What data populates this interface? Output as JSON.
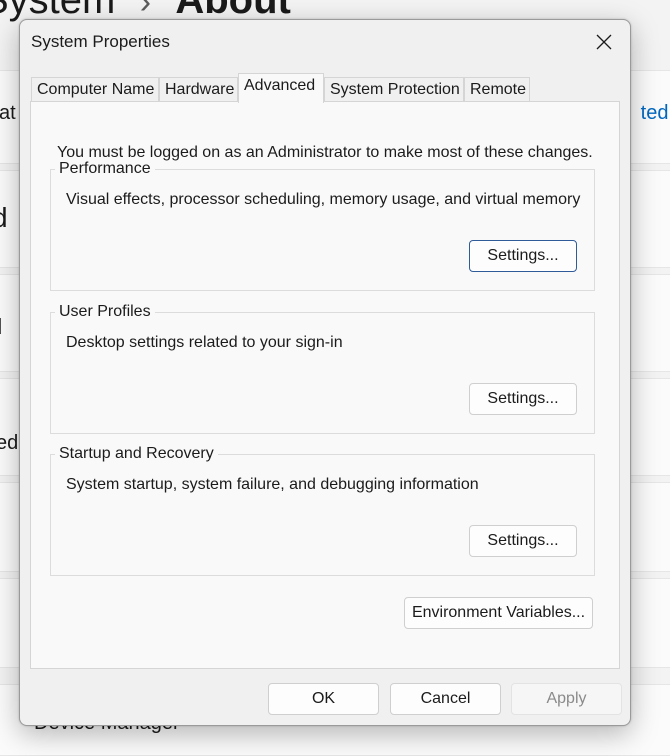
{
  "background": {
    "breadcrumb": "System",
    "page_title": "About",
    "fragment_1": "at",
    "fragment_2": "d",
    "fragment_3": "ed",
    "fragment_4": "d",
    "link_fragment": "ted s",
    "bottom_item": "Device Manager"
  },
  "dialog": {
    "title": "System Properties",
    "close_icon": "close-icon",
    "tabs": [
      "Computer Name",
      "Hardware",
      "Advanced",
      "System Protection",
      "Remote"
    ],
    "active_tab": "Advanced",
    "notice": "You must be logged on as an Administrator to make most of these changes.",
    "groups": [
      {
        "label": "Performance",
        "description": "Visual effects, processor scheduling, memory usage, and virtual memory",
        "button": "Settings..."
      },
      {
        "label": "User Profiles",
        "description": "Desktop settings related to your sign-in",
        "button": "Settings..."
      },
      {
        "label": "Startup and Recovery",
        "description": "System startup, system failure, and debugging information",
        "button": "Settings..."
      }
    ],
    "env_button": "Environment Variables...",
    "footer": {
      "ok": "OK",
      "cancel": "Cancel",
      "apply": "Apply"
    }
  }
}
